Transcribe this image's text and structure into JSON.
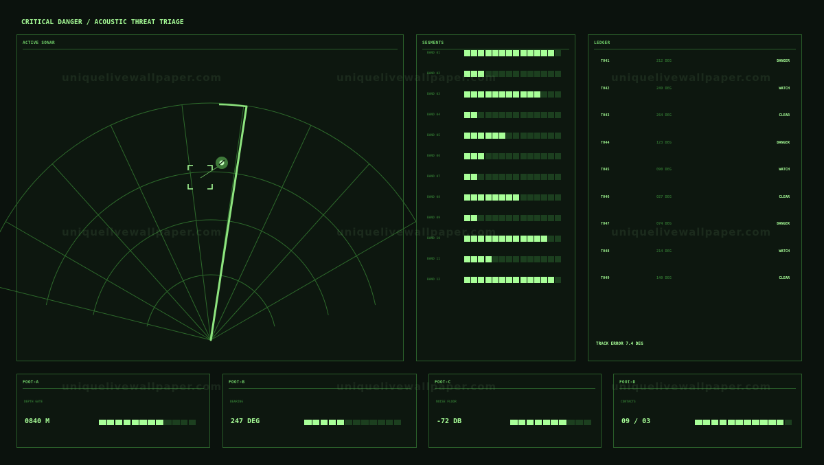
{
  "title": "CRITICAL DANGER / ACOUSTIC THREAT TRIAGE",
  "sonar": {
    "heading": "ACTIVE SONAR",
    "contact_icon": "contact-marker-icon",
    "target_icon": "target-reticle-icon"
  },
  "segments": {
    "heading": "SEGMENTS",
    "total_cells": 14,
    "bands": [
      {
        "label": "BAND 01",
        "filled": 13
      },
      {
        "label": "BAND 02",
        "filled": 3
      },
      {
        "label": "BAND 03",
        "filled": 11
      },
      {
        "label": "BAND 04",
        "filled": 2
      },
      {
        "label": "BAND 05",
        "filled": 6
      },
      {
        "label": "BAND 06",
        "filled": 3
      },
      {
        "label": "BAND 07",
        "filled": 2
      },
      {
        "label": "BAND 08",
        "filled": 8
      },
      {
        "label": "BAND 09",
        "filled": 2
      },
      {
        "label": "BAND 10",
        "filled": 12
      },
      {
        "label": "BAND 11",
        "filled": 4
      },
      {
        "label": "BAND 12",
        "filled": 13
      }
    ]
  },
  "ledger": {
    "heading": "LEDGER",
    "rows": [
      {
        "id": "T041",
        "bearing": "212 DEG",
        "status": "DANGER"
      },
      {
        "id": "T042",
        "bearing": "249 DEG",
        "status": "WATCH"
      },
      {
        "id": "T043",
        "bearing": "264 DEG",
        "status": "CLEAR"
      },
      {
        "id": "T044",
        "bearing": "123 DEG",
        "status": "DANGER"
      },
      {
        "id": "T045",
        "bearing": "090 DEG",
        "status": "WATCH"
      },
      {
        "id": "T046",
        "bearing": "027 DEG",
        "status": "CLEAR"
      },
      {
        "id": "T047",
        "bearing": "074 DEG",
        "status": "DANGER"
      },
      {
        "id": "T048",
        "bearing": "214 DEG",
        "status": "WATCH"
      },
      {
        "id": "T049",
        "bearing": "140 DEG",
        "status": "CLEAR"
      }
    ],
    "track_error": "TRACK ERROR 7.4 DEG"
  },
  "footer": [
    {
      "heading": "FOOT-A",
      "label": "DEPTH GATE",
      "value": "0840 M",
      "filled": 8,
      "total": 12
    },
    {
      "heading": "FOOT-B",
      "label": "BEARING",
      "value": "247 DEG",
      "filled": 5,
      "total": 12
    },
    {
      "heading": "FOOT-C",
      "label": "NOISE FLOOR",
      "value": "-72 DB",
      "filled": 7,
      "total": 10
    },
    {
      "heading": "FOOT-D",
      "label": "CONTACTS",
      "value": "09 / 03",
      "filled": 11,
      "total": 12
    }
  ],
  "watermark": "uniquelivewallpaper.com",
  "colors": {
    "accent": "#a8ff98",
    "grid": "#2f6f2f",
    "dim": "#1c3f1f",
    "background": "#0b120d"
  }
}
